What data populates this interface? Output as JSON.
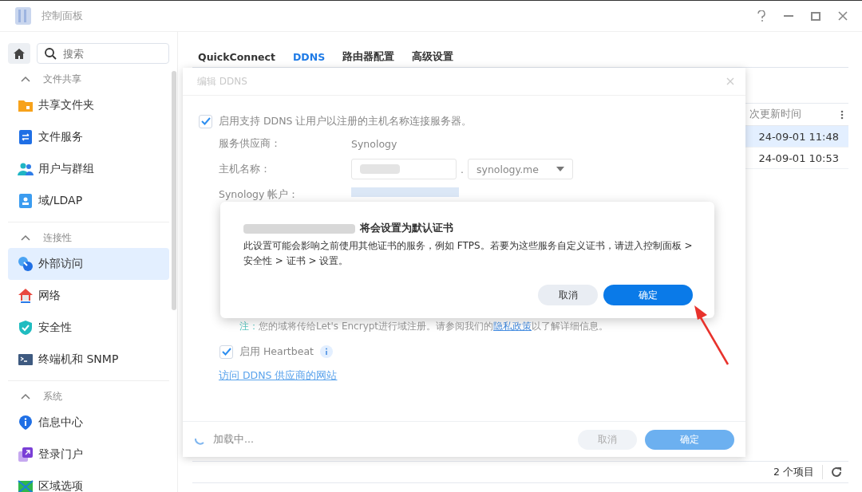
{
  "window": {
    "title": "控制面板"
  },
  "sidebar": {
    "search": {
      "placeholder": "搜索"
    },
    "sections": [
      {
        "label": "文件共享",
        "expanded": true,
        "items": [
          {
            "label": "共享文件夹",
            "selected": false
          },
          {
            "label": "文件服务",
            "selected": false
          },
          {
            "label": "用户与群组",
            "selected": false
          },
          {
            "label": "域/LDAP",
            "selected": false
          }
        ]
      },
      {
        "label": "连接性",
        "expanded": true,
        "items": [
          {
            "label": "外部访问",
            "selected": true
          },
          {
            "label": "网络",
            "selected": false
          },
          {
            "label": "安全性",
            "selected": false
          },
          {
            "label": "终端机和 SNMP",
            "selected": false
          }
        ]
      },
      {
        "label": "系统",
        "expanded": true,
        "items": [
          {
            "label": "信息中心",
            "selected": false
          },
          {
            "label": "登录门户",
            "selected": false
          },
          {
            "label": "区域选项",
            "selected": false
          }
        ]
      }
    ]
  },
  "tabs": [
    {
      "label": "QuickConnect",
      "selected": false
    },
    {
      "label": "DDNS",
      "selected": true
    },
    {
      "label": "路由器配置",
      "selected": false
    },
    {
      "label": "高级设置",
      "selected": false
    }
  ],
  "table": {
    "columns": [
      "次更新时间"
    ],
    "rows": [
      {
        "column_1": "24-09-01 11:48",
        "selected": true
      },
      {
        "column_1": "24-09-01 10:53",
        "selected": false
      }
    ],
    "count": "2 个项目"
  },
  "edit_dialog": {
    "title": "编辑 DDNS",
    "enable": {
      "label": "启用支持 DDNS 让用户以注册的主机名称连接服务器。",
      "checked": true
    },
    "fields": [
      {
        "label": "服务供应商：",
        "kind": "text",
        "value": "Synology"
      },
      {
        "label": "主机名称：",
        "kind": "hostname",
        "separator": ".",
        "suffix": "synology.me"
      },
      {
        "label": "Synology 帐户：",
        "kind": "redacted"
      }
    ],
    "note": {
      "label": "注：",
      "before": "您的域将传给Let's Encrypt进行域注册。请参阅我们的",
      "link": "隐私政策",
      "after": "以了解详细信息。"
    },
    "heartbeat": {
      "label": "启用 Heartbeat",
      "checked": true
    },
    "link": "访问 DDNS 供应商的网站",
    "loading": "加载中...",
    "buttons": [
      {
        "label": "取消",
        "kind": "secondary"
      },
      {
        "label": "确定",
        "kind": "primary"
      }
    ]
  },
  "confirm_dialog": {
    "title": "将会设置为默认证书",
    "message": "此设置可能会影响之前使用其他证书的服务，例如 FTPS。若要为这些服务自定义证书，请进入控制面板 > 安全性 > 证书 > 设置。",
    "buttons": [
      {
        "label": "取消",
        "kind": "secondary"
      },
      {
        "label": "确定",
        "kind": "primary"
      }
    ]
  }
}
